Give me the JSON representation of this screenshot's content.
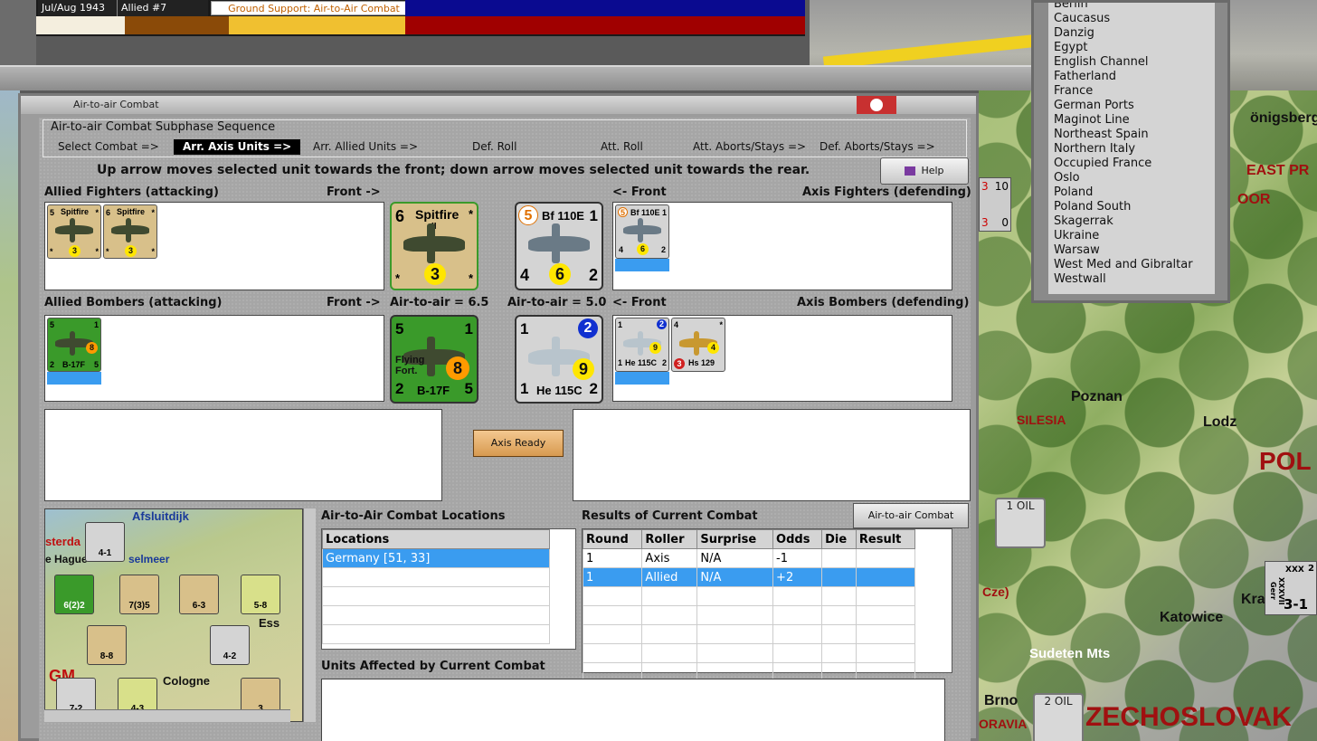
{
  "topbar": {
    "date": "Jul/Aug 1943",
    "turn": "Allied #7",
    "phase": "Ground Support: Air-to-Air Combat"
  },
  "location_list": [
    "Berlin",
    "Caucasus",
    "Danzig",
    "Egypt",
    "English Channel",
    "Fatherland",
    "France",
    "German Ports",
    "Maginot Line",
    "Northeast Spain",
    "Northern Italy",
    "Occupied France",
    "Oslo",
    "Poland",
    "Poland South",
    "Skagerrak",
    "Ukraine",
    "Warsaw",
    "West Med and Gibraltar",
    "Westwall"
  ],
  "map_labels": {
    "konigsberg": "önigsberg",
    "east_prussia": "EAST PR",
    "oor": "OOR",
    "silesia": "SILESIA",
    "poznan": "Poznan",
    "lodz": "Lodz",
    "pol": "POL",
    "katowice": "Katowice",
    "sudeten": "Sudeten Mts",
    "krakow": "Kra",
    "brno": "Brno",
    "czech": "ZECHOSLOVAK",
    "cze": "Cze)",
    "oravia": "ORAVIA",
    "oil1": "1 OIL",
    "oil2": "2 OIL",
    "stack_a": "3",
    "stack_b": "10",
    "stack_c": "3",
    "stack_d": "0",
    "corps_id": "XXXVII Gerr",
    "corps_val": "3-1",
    "corps_xxx": "XXX",
    "num2": "2"
  },
  "dialog": {
    "title": "Air-to-air Combat",
    "sequence_title": "Air-to-air Combat Subphase Sequence",
    "steps": [
      "Select Combat =>",
      "Arr. Axis Units =>",
      "Arr. Allied Units =>",
      "Def. Roll",
      "Att. Roll",
      "Att. Aborts/Stays =>",
      "Def. Aborts/Stays =>"
    ],
    "instruction": "Up arrow moves selected unit towards the front; down arrow moves selected unit towards the rear.",
    "help": "Help",
    "allied_fighters": "Allied Fighters (attacking)",
    "front_right": "Front ->",
    "front_left": "<- Front",
    "axis_fighters": "Axis Fighters (defending)",
    "allied_bombers": "Allied Bombers (attacking)",
    "axis_bombers": "Axis Bombers (defending)",
    "allied_ata": "Air-to-air = 6.5",
    "axis_ata": "Air-to-air = 5.0",
    "axis_ready": "Axis Ready",
    "locations_title": "Air-to-Air Combat Locations",
    "results_title": "Results of Current Combat",
    "chart_button": "Air-to-air Combat Chart",
    "units_affected": "Units Affected by Current Combat"
  },
  "units": {
    "spitfire": {
      "name": "Spitfire",
      "mark": "II",
      "top_left": "6",
      "top_right": "*",
      "mid": "3",
      "bl": "*",
      "br": "*"
    },
    "spitfire_small1": {
      "name": "Spitfire",
      "mark": "II",
      "tl": "5",
      "tr": "*",
      "mid": "3",
      "bl": "*",
      "br": "*"
    },
    "spitfire_small2": {
      "name": "Spitfire",
      "mark": "II",
      "tl": "6",
      "tr": "*",
      "mid": "3",
      "bl": "*",
      "br": "*"
    },
    "bf110": {
      "name": "Bf 110E",
      "tl": "5",
      "tr": "1",
      "bl": "4",
      "mid": "6",
      "br": "2"
    },
    "b17": {
      "name": "B-17F",
      "sub": "Flying Fort.",
      "tl": "5",
      "tr": "1",
      "bl": "2",
      "br": "5",
      "mid": "8"
    },
    "he115": {
      "name": "He 115C",
      "tl": "1",
      "tr": "2",
      "bl": "1",
      "mid": "9",
      "br": "2"
    },
    "hs129": {
      "name": "Hs 129",
      "tl": "4",
      "tr": "*",
      "mid": "4",
      "bl": "3"
    }
  },
  "minimap": {
    "afsluitdijk": "Afsluitdijk",
    "sterda": "sterda",
    "hague": "e Hague",
    "selmeer": "selmeer",
    "cologne": "Cologne",
    "ess": "Ess",
    "gm": "GM",
    "u1": "4-1",
    "u2": "6(2)2",
    "u3": "7(3)5",
    "u4": "6-3",
    "u5": "5-8",
    "u6": "8-8",
    "u7": "4-2",
    "u8": "7-2",
    "u9": "4-3",
    "u10": "3"
  },
  "locations_table": {
    "header": "Locations",
    "rows": [
      "Germany [51, 33]"
    ]
  },
  "results_table": {
    "headers": [
      "Round",
      "Roller",
      "Surprise",
      "Odds",
      "Die",
      "Result"
    ],
    "rows": [
      [
        "1",
        "Axis",
        "N/A",
        "-1",
        "",
        ""
      ],
      [
        "1",
        "Allied",
        "N/A",
        "+2",
        "",
        ""
      ]
    ]
  }
}
